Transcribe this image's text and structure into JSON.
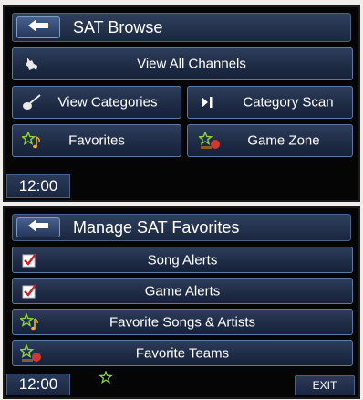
{
  "browse": {
    "title": "SAT Browse",
    "view_all": "View All Channels",
    "view_categories": "View Categories",
    "category_scan": "Category Scan",
    "favorites": "Favorites",
    "game_zone": "Game Zone",
    "time": "12:00"
  },
  "favorites_menu": {
    "title": "Manage SAT Favorites",
    "song_alerts": "Song Alerts",
    "game_alerts": "Game Alerts",
    "favorite_songs_artists": "Favorite Songs & Artists",
    "favorite_teams": "Favorite Teams",
    "time": "12:00",
    "exit": "EXIT"
  },
  "icons": {
    "back": "left-arrow-icon",
    "channels": "dog-icon",
    "categories": "guitar-icon",
    "scan": "skip-forward-icon",
    "favorites": "star-note-icon",
    "game_zone": "star-ball-icon",
    "song_alert_check": "checkbox-checked-icon",
    "game_alert_check": "checkbox-checked-icon",
    "favorite_star": "star-outline-icon"
  },
  "colors": {
    "button_border": "#5d79a3",
    "button_fill": "#1f2c46",
    "screen_bg": "#050505",
    "checkmark": "#d11f2a",
    "star_green": "#8dd04a"
  }
}
